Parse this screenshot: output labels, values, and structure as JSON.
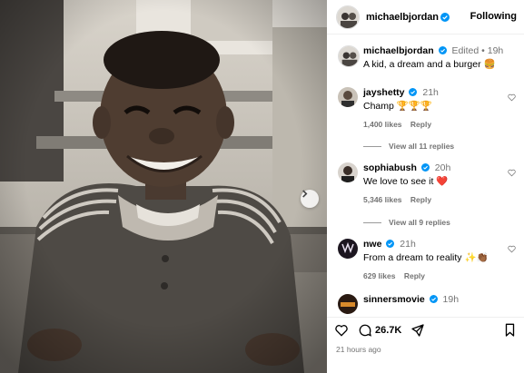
{
  "post": {
    "author": "michaelbjordan",
    "follow_label": "Following",
    "caption_edited": "Edited",
    "caption_time": "19h",
    "caption_text": "A kid, a dream and a burger 🍔",
    "photo_description_icon": "black-and-white-child-photo",
    "likes_count": "26.7K",
    "posted_ago": "21 hours ago"
  },
  "comments": [
    {
      "username": "jayshetty",
      "time": "21h",
      "text": "Champ 🏆🏆🏆",
      "likes": "1,400 likes",
      "reply": "Reply",
      "view_replies": "View all 11 replies"
    },
    {
      "username": "sophiabush",
      "time": "20h",
      "text": "We love to see it ❤️",
      "likes": "5,346 likes",
      "reply": "Reply",
      "view_replies": "View all 9 replies"
    },
    {
      "username": "nwe",
      "time": "21h",
      "text": "From a dream to reality ✨👏🏾",
      "likes": "629 likes",
      "reply": "Reply"
    },
    {
      "username": "sinnersmovie",
      "time": "19h",
      "text": ""
    }
  ],
  "colors": {
    "verified": "#0095f6",
    "muted": "#737373",
    "heart_red": "#e0245e"
  }
}
